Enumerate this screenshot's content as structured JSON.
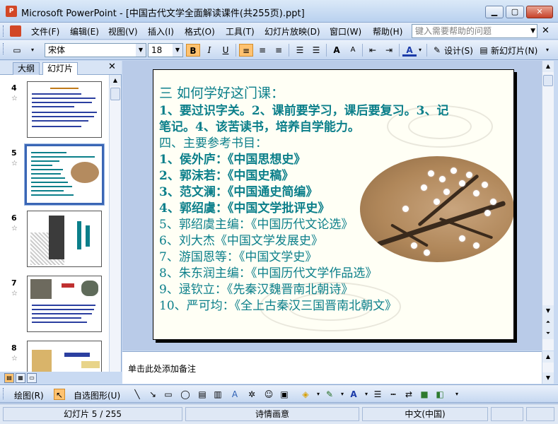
{
  "window": {
    "app_name": "Microsoft PowerPoint",
    "title": "Microsoft PowerPoint - [中国古代文学全面解读课件(共255页).ppt]"
  },
  "menu": {
    "items": [
      "文件(F)",
      "编辑(E)",
      "视图(V)",
      "插入(I)",
      "格式(O)",
      "工具(T)",
      "幻灯片放映(D)",
      "窗口(W)",
      "帮助(H)"
    ],
    "help_placeholder": "键入需要帮助的问题"
  },
  "format_toolbar": {
    "font": "宋体",
    "size": "18",
    "bold": "B",
    "italic": "I",
    "underline": "U",
    "design_label": "设计(S)",
    "new_slide_label": "新幻灯片(N)"
  },
  "left_pane": {
    "tabs": [
      "大纲",
      "幻灯片"
    ],
    "thumbnails": [
      {
        "number": "4",
        "selected": false
      },
      {
        "number": "5",
        "selected": true
      },
      {
        "number": "6",
        "selected": false
      },
      {
        "number": "7",
        "selected": false
      },
      {
        "number": "8",
        "selected": false
      }
    ]
  },
  "slide": {
    "title": "三 如何学好这门课：",
    "lines": [
      "1、要过识字关。2、课前要学习，课后要复习。3、记",
      "笔记。4、该苦读书，培养自学能力。",
      "四、主要参考书目：",
      "1、侯外庐：《中国思想史》",
      "2、郭沫若：《中国史稿》",
      "3、范文澜：《中国通史简编》",
      "4、郭绍虞：《中国文学批评史》",
      "5、郭绍虞主编：《中国历代文论选》",
      "6、刘大杰《中国文学发展史》",
      "7、游国恩等：《中国文学史》",
      "8、朱东润主编：《中国历代文学作品选》",
      "9、逯钦立：《先秦汉魏晋南北朝诗》",
      "10、严可均：《全上古秦汉三国晋南北朝文》"
    ]
  },
  "notes": {
    "placeholder": "单击此处添加备注"
  },
  "draw_toolbar": {
    "draw_label": "绘图(R)",
    "autoshapes_label": "自选图形(U)"
  },
  "status": {
    "slide_info": "幻灯片 5 / 255",
    "design_name": "诗情画意",
    "language": "中文(中国)"
  },
  "colors": {
    "slide_text": "#0b7f8a",
    "slide_bg": "#fffff5",
    "selection": "#3a66b5"
  }
}
